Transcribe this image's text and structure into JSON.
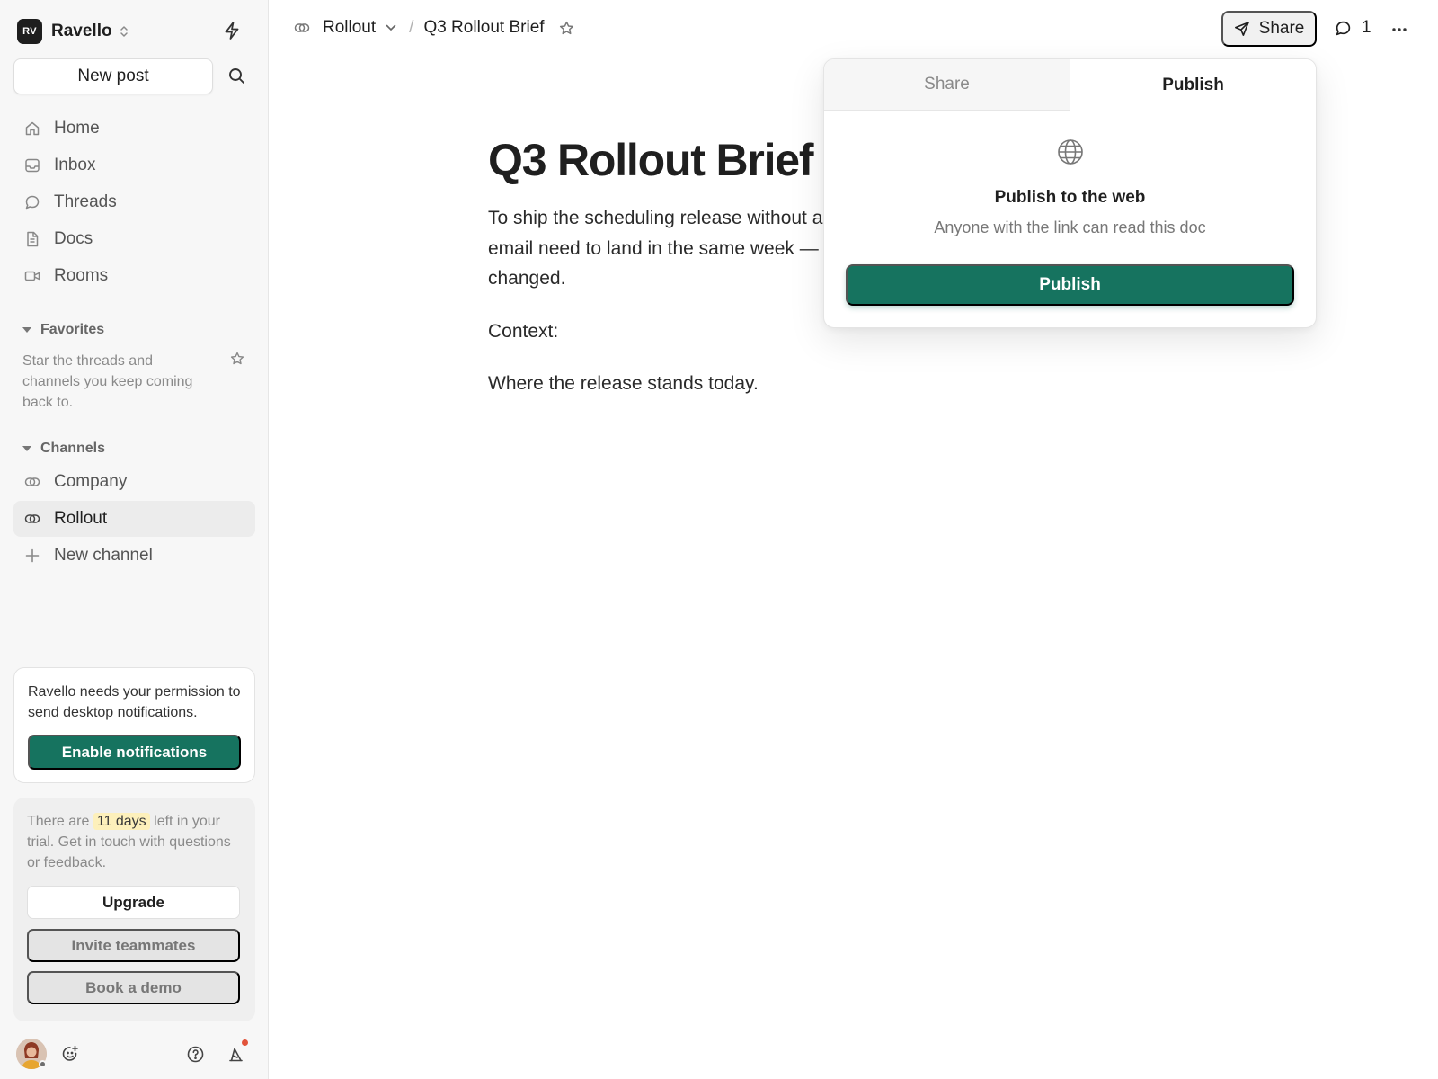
{
  "workspace": {
    "initials": "RV",
    "name": "Ravello"
  },
  "sidebar": {
    "new_post": "New post",
    "nav": [
      {
        "label": "Home",
        "icon": "home-icon"
      },
      {
        "label": "Inbox",
        "icon": "inbox-icon"
      },
      {
        "label": "Threads",
        "icon": "chat-bubble-icon"
      },
      {
        "label": "Docs",
        "icon": "document-icon"
      },
      {
        "label": "Rooms",
        "icon": "video-icon"
      }
    ],
    "favorites": {
      "heading": "Favorites",
      "empty_text": "Star the threads and channels you keep coming back to."
    },
    "channels": {
      "heading": "Channels",
      "items": [
        {
          "label": "Company",
          "icon": "channel-icon"
        },
        {
          "label": "Rollout",
          "icon": "channel-icon",
          "active": true
        }
      ],
      "new_channel": "New channel"
    },
    "notifications_card": {
      "text": "Ravello needs your permission to send desktop notifications.",
      "button": "Enable notifications"
    },
    "trial_card": {
      "text_before": "There are",
      "days": "11 days",
      "text_after": "left in your trial. Get in touch with questions or feedback.",
      "upgrade": "Upgrade",
      "invite": "Invite teammates",
      "demo": "Book a demo"
    }
  },
  "topbar": {
    "channel": "Rollout",
    "doc_title": "Q3 Rollout Brief",
    "share_label": "Share",
    "comment_count": "1"
  },
  "document": {
    "title": "Q3 Rollout Brief",
    "paragraph1_line1": "To ship the scheduling release without a",
    "paragraph1_line2": "email need to land in the same week — a",
    "paragraph1_line3": "changed.",
    "paragraph2": "Context:",
    "paragraph3": "Where the release stands today."
  },
  "share_popover": {
    "tabs": [
      "Share",
      "Publish"
    ],
    "active_tab": "Publish",
    "heading": "Publish to the web",
    "subtext": "Anyone with the link can read this doc",
    "button": "Publish"
  },
  "colors": {
    "accent_green": "#16735f",
    "highlight": "#fdf0bb",
    "badge_red": "#e2533a"
  }
}
